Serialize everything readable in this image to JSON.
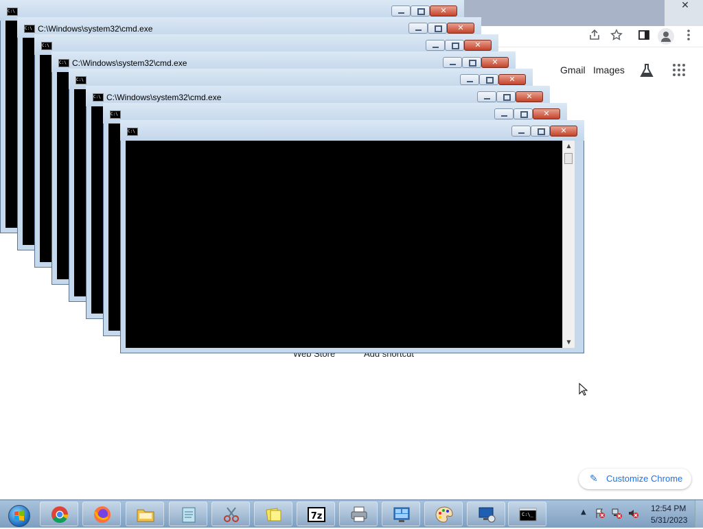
{
  "chrome": {
    "close_glyph": "✕",
    "header": {
      "gmail": "Gmail",
      "images": "Images"
    },
    "shortcuts": {
      "web_store": "Web Store",
      "add_shortcut": "Add shortcut"
    },
    "customize": "Customize Chrome"
  },
  "cmd_windows": [
    {
      "title": ""
    },
    {
      "title": "C:\\Windows\\system32\\cmd.exe"
    },
    {
      "title": ""
    },
    {
      "title": "C:\\Windows\\system32\\cmd.exe"
    },
    {
      "title": ""
    },
    {
      "title": "C:\\Windows\\system32\\cmd.exe"
    },
    {
      "title": ""
    },
    {
      "title": ""
    }
  ],
  "taskbar": {
    "items": [
      "chrome",
      "firefox",
      "file-explorer",
      "notepad",
      "snipping-tool",
      "sticky-notes",
      "7-zip",
      "printer",
      "control-panel",
      "paint",
      "remote-desktop",
      "cmd"
    ],
    "clock": {
      "time": "12:54 PM",
      "date": "5/31/2023"
    }
  }
}
